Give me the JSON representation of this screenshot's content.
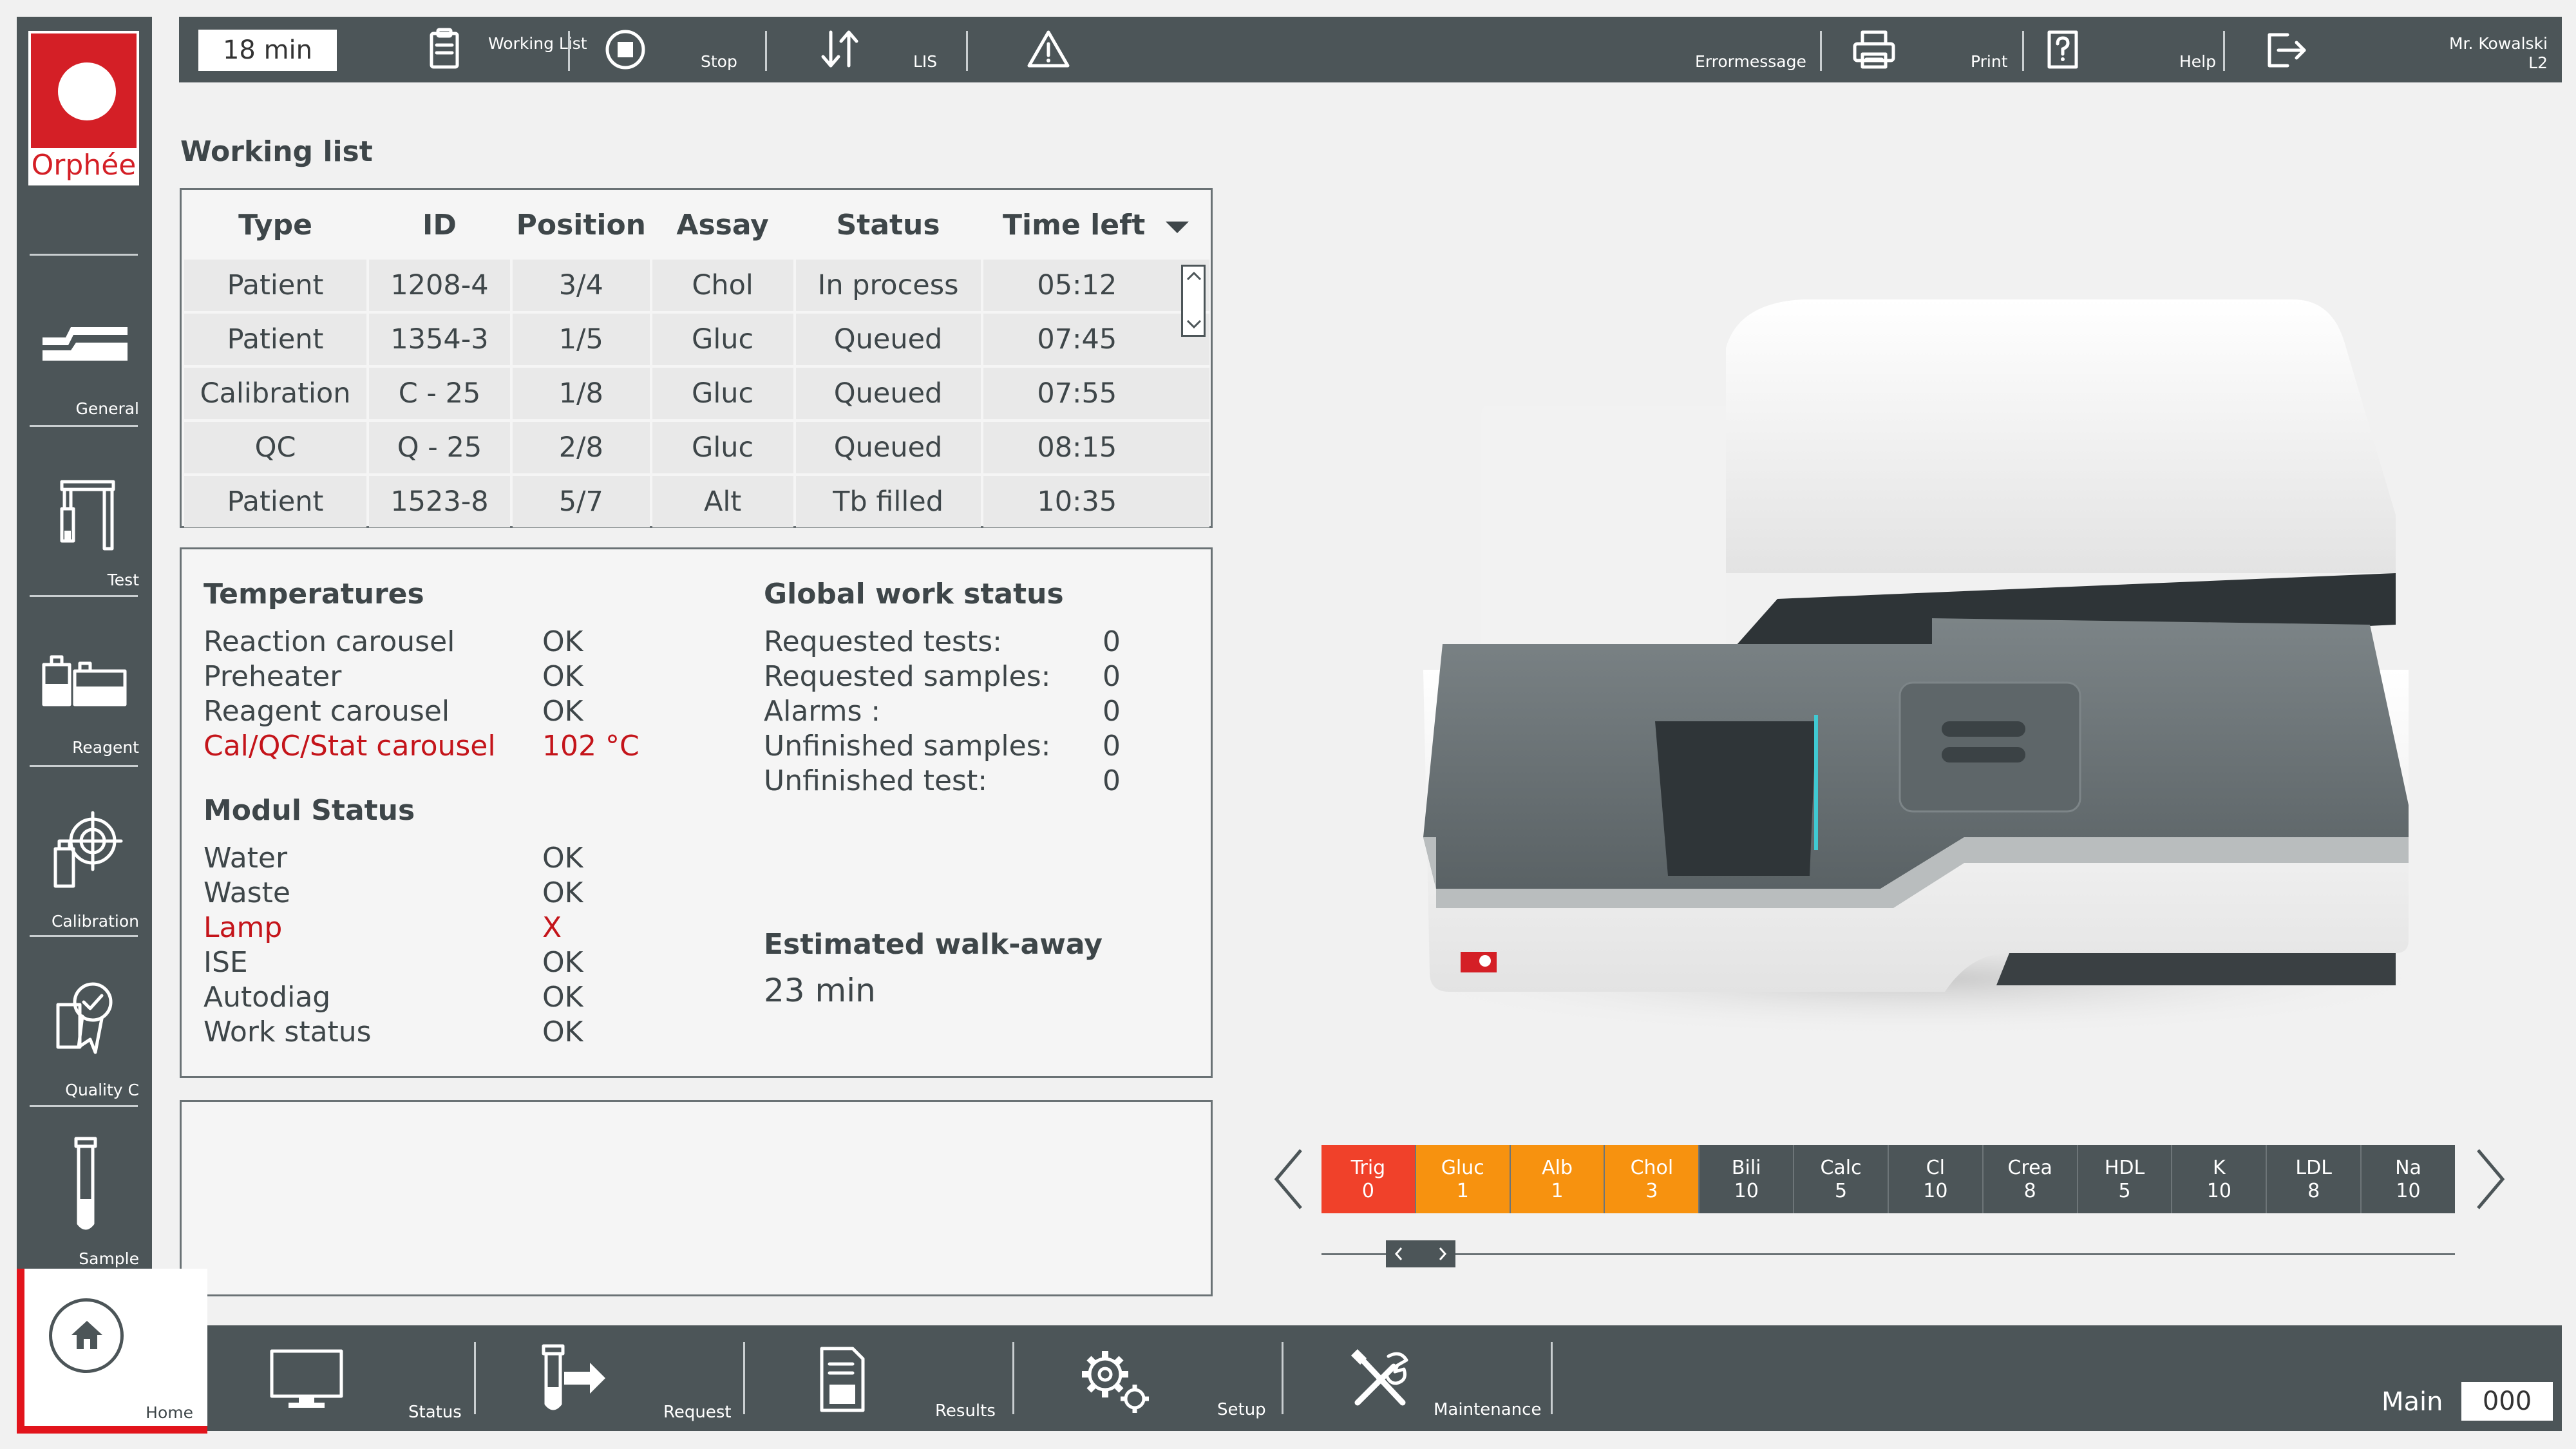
{
  "topbar": {
    "timer": "18 min",
    "working_list_label": "Working List",
    "stop_label": "Stop",
    "lis_label": "LIS",
    "errormessage_label": "Errormessage",
    "print_label": "Print",
    "help_label": "Help",
    "user_name": "Mr. Kowalski",
    "user_level": "L2"
  },
  "logo": {
    "text": "Orphée",
    "color": "#d41f26"
  },
  "sidebar": {
    "items": [
      {
        "label": "General",
        "icon": "tray-icon"
      },
      {
        "label": "Test",
        "icon": "pipette-icon"
      },
      {
        "label": "Reagent",
        "icon": "reagent-bottles-icon"
      },
      {
        "label": "Calibration",
        "icon": "target-icon"
      },
      {
        "label": "Quality C",
        "icon": "quality-badge-icon"
      },
      {
        "label": "Sample",
        "icon": "test-tube-icon"
      }
    ]
  },
  "working_list": {
    "title": "Working list",
    "columns": [
      "Type",
      "ID",
      "Position",
      "Assay",
      "Status",
      "Time left"
    ],
    "rows": [
      [
        "Patient",
        "1208-4",
        "3/4",
        "Chol",
        "In process",
        "05:12"
      ],
      [
        "Patient",
        "1354-3",
        "1/5",
        "Gluc",
        "Queued",
        "07:45"
      ],
      [
        "Calibration",
        "C - 25",
        "1/8",
        "Gluc",
        "Queued",
        "07:55"
      ],
      [
        "QC",
        "Q - 25",
        "2/8",
        "Gluc",
        "Queued",
        "08:15"
      ],
      [
        "Patient",
        "1523-8",
        "5/7",
        "Alt",
        "Tb filled",
        "10:35"
      ]
    ]
  },
  "temperatures": {
    "title": "Temperatures",
    "items": [
      {
        "name": "Reaction carousel",
        "value": "OK",
        "alert": false
      },
      {
        "name": "Preheater",
        "value": "OK",
        "alert": false
      },
      {
        "name": "Reagent carousel",
        "value": "OK",
        "alert": false
      },
      {
        "name": "Cal/QC/Stat carousel",
        "value": "102 °C",
        "alert": true
      }
    ]
  },
  "modul_status": {
    "title": "Modul Status",
    "items": [
      {
        "name": "Water",
        "value": "OK",
        "alert": false
      },
      {
        "name": "Waste",
        "value": "OK",
        "alert": false
      },
      {
        "name": "Lamp",
        "value": "X",
        "alert": true
      },
      {
        "name": "ISE",
        "value": "OK",
        "alert": false
      },
      {
        "name": "Autodiag",
        "value": "OK",
        "alert": false
      },
      {
        "name": "Work status",
        "value": "OK",
        "alert": false
      }
    ]
  },
  "global_work_status": {
    "title": "Global work status",
    "items": [
      {
        "name": "Requested tests:",
        "value": "0"
      },
      {
        "name": "Requested samples:",
        "value": "0"
      },
      {
        "name": "Alarms :",
        "value": "0"
      },
      {
        "name": "Unfinished samples:",
        "value": "0"
      },
      {
        "name": "Unfinished test:",
        "value": "0"
      }
    ]
  },
  "walkaway": {
    "title": "Estimated walk-away",
    "value": "23 min"
  },
  "assays": [
    {
      "name": "Trig",
      "count": "0",
      "color": "#f0412a"
    },
    {
      "name": "Gluc",
      "count": "1",
      "color": "#f7920f"
    },
    {
      "name": "Alb",
      "count": "1",
      "color": "#f7920f"
    },
    {
      "name": "Chol",
      "count": "3",
      "color": "#f7920f"
    },
    {
      "name": "Bili",
      "count": "10",
      "color": "#4c5558"
    },
    {
      "name": "Calc",
      "count": "5",
      "color": "#4c5558"
    },
    {
      "name": "Cl",
      "count": "10",
      "color": "#4c5558"
    },
    {
      "name": "Crea",
      "count": "8",
      "color": "#4c5558"
    },
    {
      "name": "HDL",
      "count": "5",
      "color": "#4c5558"
    },
    {
      "name": "K",
      "count": "10",
      "color": "#4c5558"
    },
    {
      "name": "LDL",
      "count": "8",
      "color": "#4c5558"
    },
    {
      "name": "Na",
      "count": "10",
      "color": "#4c5558"
    }
  ],
  "bottombar": {
    "home_label": "Home",
    "status_label": "Status",
    "request_label": "Request",
    "results_label": "Results",
    "setup_label": "Setup",
    "maintenance_label": "Maintenance",
    "main_label": "Main",
    "main_value": "000"
  },
  "colors": {
    "bar": "#4c5558",
    "alert": "#c4141a",
    "accent_red": "#e2141c"
  }
}
